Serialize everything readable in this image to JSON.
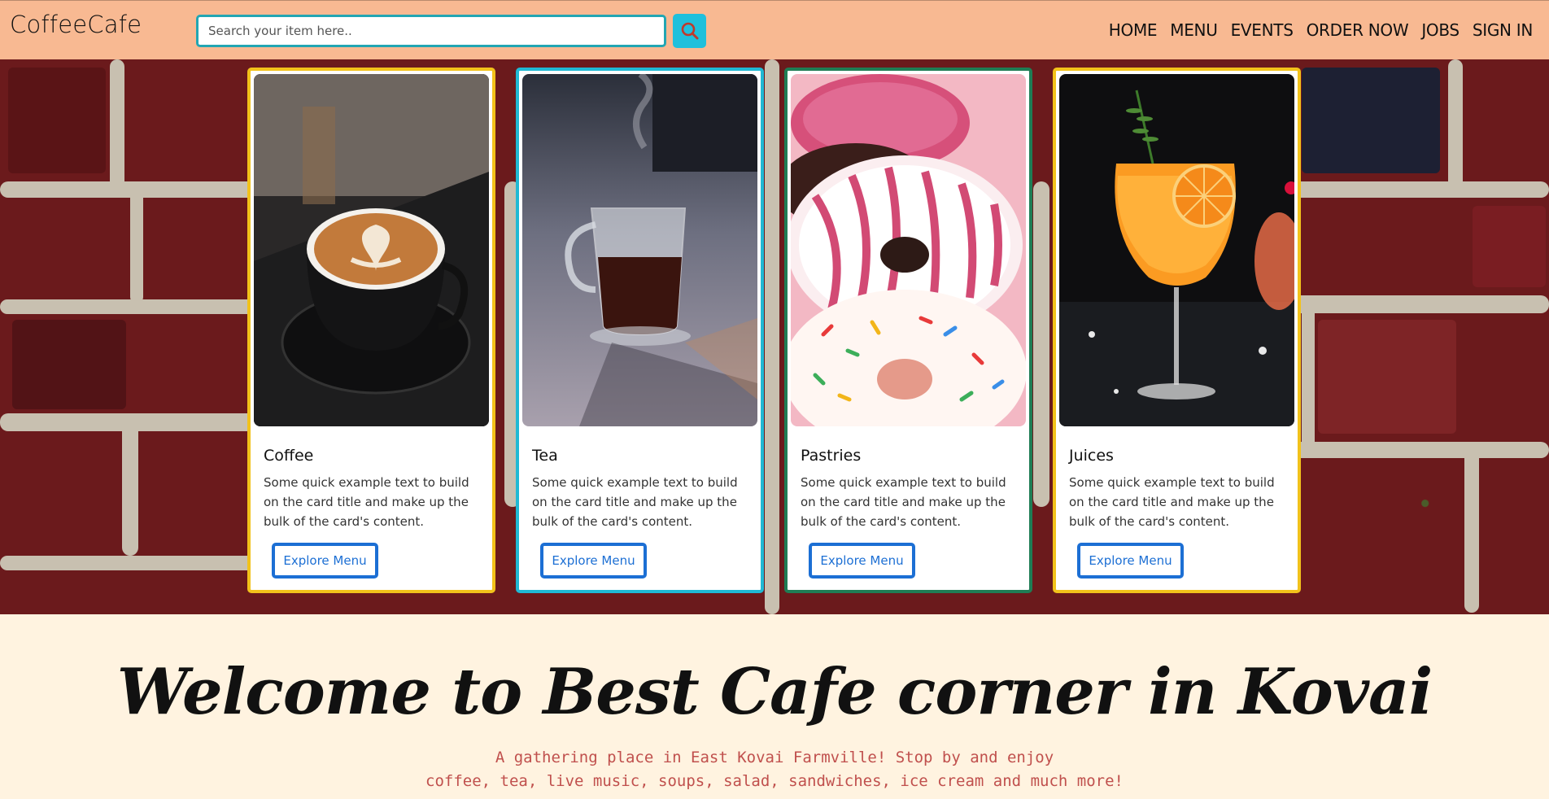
{
  "header": {
    "brand": "CoffeeCafe",
    "search": {
      "placeholder": "Search your item here..",
      "value": ""
    },
    "search_icon": "search-icon",
    "nav": [
      "HOME",
      "MENU",
      "EVENTS",
      "ORDER NOW",
      "JOBS",
      "SIGN IN"
    ]
  },
  "cards": [
    {
      "title": "Coffee",
      "text": "Some quick example text to build on the card title and make up the bulk of the card's content.",
      "button": "Explore Menu",
      "image": "latte-cup-photo",
      "border_color": "#f2c21b"
    },
    {
      "title": "Tea",
      "text": "Some quick example text to build on the card title and make up the bulk of the card's content.",
      "button": "Explore Menu",
      "image": "glass-tea-cup-photo",
      "border_color": "#20b9d4"
    },
    {
      "title": "Pastries",
      "text": "Some quick example text to build on the card title and make up the bulk of the card's content.",
      "button": "Explore Menu",
      "image": "donuts-photo",
      "border_color": "#1f7d55"
    },
    {
      "title": "Juices",
      "text": "Some quick example text to build on the card title and make up the bulk of the card's content.",
      "button": "Explore Menu",
      "image": "orange-cocktail-photo",
      "border_color": "#f2c21b"
    }
  ],
  "welcome": {
    "title": "Welcome to Best Cafe corner in Kovai",
    "subtitle_line1": "A gathering place in East Kovai Farmville! Stop by and enjoy",
    "subtitle_line2": "coffee, tea, live music, soups, salad, sandwiches, ice cream and much more!"
  },
  "colors": {
    "navbar_bg": "#f8b992",
    "search_border": "#22a6b3",
    "search_button": "#1fc0dc",
    "button_primary": "#1c6fd4",
    "welcome_bg": "#fff3e0",
    "subtitle_color": "#c0504d"
  }
}
